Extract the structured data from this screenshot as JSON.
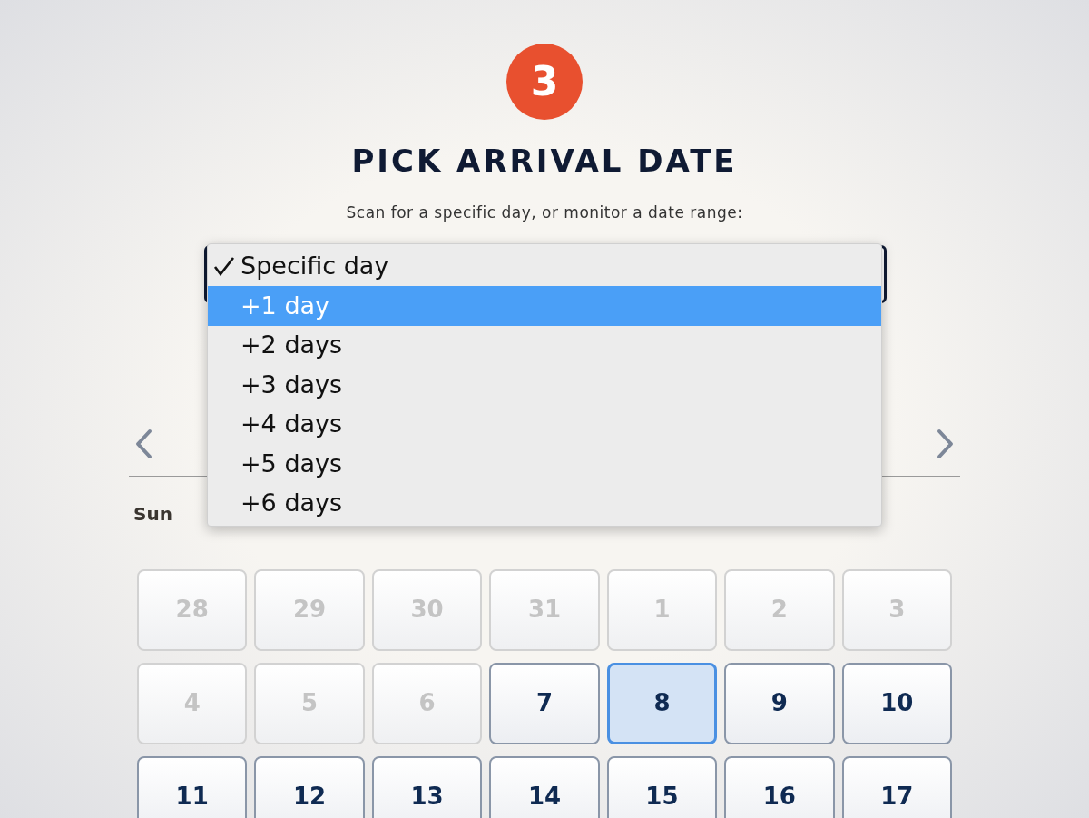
{
  "step": {
    "number": "3",
    "title": "PICK ARRIVAL DATE",
    "subtitle": "Scan for a specific day, or monitor a date range:"
  },
  "range_menu": {
    "options": [
      {
        "label": "Specific day",
        "checked": true,
        "highlighted": false
      },
      {
        "label": "+1 day",
        "checked": false,
        "highlighted": true
      },
      {
        "label": "+2 days",
        "checked": false,
        "highlighted": false
      },
      {
        "label": "+3 days",
        "checked": false,
        "highlighted": false
      },
      {
        "label": "+4 days",
        "checked": false,
        "highlighted": false
      },
      {
        "label": "+5 days",
        "checked": false,
        "highlighted": false
      },
      {
        "label": "+6 days",
        "checked": false,
        "highlighted": false
      }
    ]
  },
  "calendar": {
    "weekdays": [
      "Sun"
    ],
    "days": [
      {
        "label": "28",
        "disabled": true,
        "selected": false
      },
      {
        "label": "29",
        "disabled": true,
        "selected": false
      },
      {
        "label": "30",
        "disabled": true,
        "selected": false
      },
      {
        "label": "31",
        "disabled": true,
        "selected": false
      },
      {
        "label": "1",
        "disabled": true,
        "selected": false
      },
      {
        "label": "2",
        "disabled": true,
        "selected": false
      },
      {
        "label": "3",
        "disabled": true,
        "selected": false
      },
      {
        "label": "4",
        "disabled": true,
        "selected": false
      },
      {
        "label": "5",
        "disabled": true,
        "selected": false
      },
      {
        "label": "6",
        "disabled": true,
        "selected": false
      },
      {
        "label": "7",
        "disabled": false,
        "selected": false
      },
      {
        "label": "8",
        "disabled": false,
        "selected": true
      },
      {
        "label": "9",
        "disabled": false,
        "selected": false
      },
      {
        "label": "10",
        "disabled": false,
        "selected": false
      },
      {
        "label": "11",
        "disabled": false,
        "selected": false
      },
      {
        "label": "12",
        "disabled": false,
        "selected": false
      },
      {
        "label": "13",
        "disabled": false,
        "selected": false
      },
      {
        "label": "14",
        "disabled": false,
        "selected": false
      },
      {
        "label": "15",
        "disabled": false,
        "selected": false
      },
      {
        "label": "16",
        "disabled": false,
        "selected": false
      },
      {
        "label": "17",
        "disabled": false,
        "selected": false
      }
    ]
  }
}
